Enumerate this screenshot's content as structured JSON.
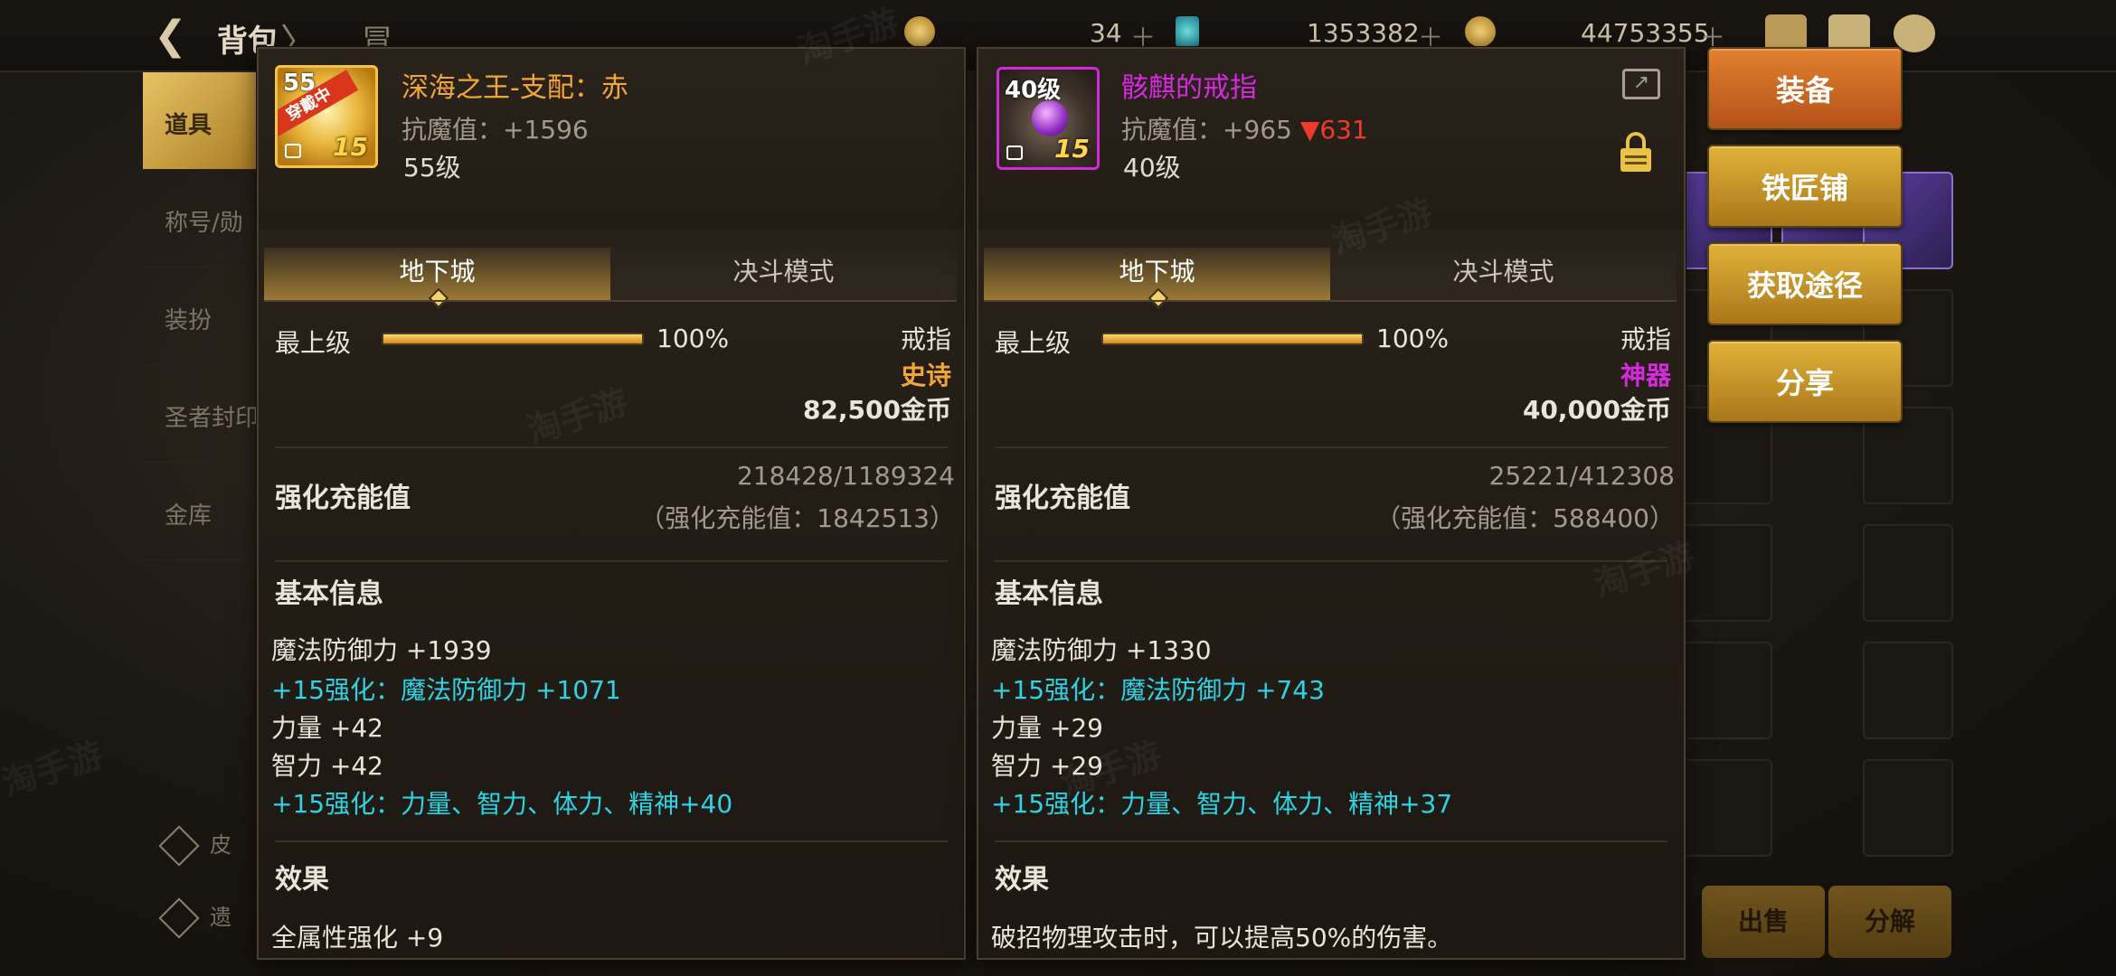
{
  "background": {
    "title": "背包",
    "title_extra": "〉",
    "title_extra2": "冒",
    "currency": [
      {
        "value": "34",
        "icon": "gold-coin-icon"
      },
      {
        "value": "1353382",
        "icon": "blue-crystal-icon"
      },
      {
        "value": "44753355",
        "icon": "gold-coin-icon"
      }
    ],
    "left_tabs": [
      "道具",
      "称号/勋",
      "装扮",
      "圣者封印",
      "金库"
    ],
    "left_small": [
      "皮",
      "遗"
    ],
    "bottom_buttons": [
      "出售",
      "分解"
    ]
  },
  "panel_left": {
    "name": "深海之王-支配：赤",
    "name_color": "#f3a638",
    "icon_level": "55",
    "icon_ribbon": "穿戴中",
    "icon_plus": "15",
    "resist": "抗魔值：+1596",
    "level": "55级",
    "tabs": [
      "地下城",
      "决斗模式"
    ],
    "grade_label": "最上级",
    "grade_pct": "100%",
    "grade_value": 1.0,
    "slot": "戒指",
    "rarity": "史诗",
    "rarity_color": "#f3a638",
    "price": "82,500金币",
    "charge_label": "强化充能值",
    "charge_value": "218428/1189324",
    "charge_total": "（强化充能值：1842513）",
    "basic_title": "基本信息",
    "stats": [
      {
        "text": "魔法防御力 +1939",
        "cyan": false
      },
      {
        "text": "+15强化：魔法防御力 +1071",
        "cyan": true
      },
      {
        "text": "力量 +42",
        "cyan": false
      },
      {
        "text": "智力 +42",
        "cyan": false
      },
      {
        "text": "+15强化：力量、智力、体力、精神+40",
        "cyan": true
      }
    ],
    "effect_title": "效果",
    "effect_text": "全属性强化 +9"
  },
  "panel_right": {
    "name": "骸麒的戒指",
    "name_color": "#d62adf",
    "icon_level": "40级",
    "icon_plus": "15",
    "resist_prefix": "抗魔值：+965",
    "resist_down": "▼631",
    "level": "40级",
    "tabs": [
      "地下城",
      "决斗模式"
    ],
    "grade_label": "最上级",
    "grade_pct": "100%",
    "grade_value": 1.0,
    "slot": "戒指",
    "rarity": "神器",
    "rarity_color": "#d62adf",
    "price": "40,000金币",
    "charge_label": "强化充能值",
    "charge_value": "25221/412308",
    "charge_total": "（强化充能值：588400）",
    "basic_title": "基本信息",
    "stats": [
      {
        "text": "魔法防御力 +1330",
        "cyan": false
      },
      {
        "text": "+15强化：魔法防御力 +743",
        "cyan": true
      },
      {
        "text": "力量 +29",
        "cyan": false
      },
      {
        "text": "智力 +29",
        "cyan": false
      },
      {
        "text": "+15强化：力量、智力、体力、精神+37",
        "cyan": true
      }
    ],
    "effect_title": "效果",
    "effect_text": "破招物理攻击时，可以提高50%的伤害。"
  },
  "actions": [
    {
      "label": "装备",
      "style": "orange"
    },
    {
      "label": "铁匠铺",
      "style": "gold"
    },
    {
      "label": "获取途径",
      "style": "gold"
    },
    {
      "label": "分享",
      "style": "gold"
    }
  ],
  "watermark": "淘手游"
}
